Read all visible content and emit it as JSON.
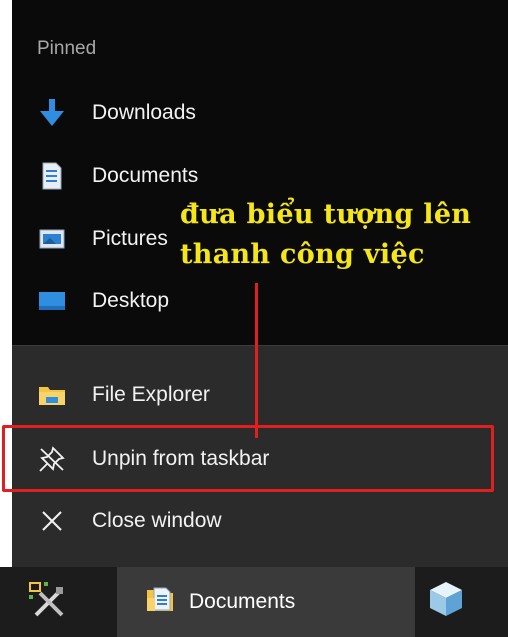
{
  "jumplist": {
    "pinned_header": "Pinned",
    "pinned_items": [
      {
        "label": "Downloads",
        "icon": "download-arrow-icon"
      },
      {
        "label": "Documents",
        "icon": "document-icon"
      },
      {
        "label": "Pictures",
        "icon": "pictures-icon"
      },
      {
        "label": "Desktop",
        "icon": "desktop-icon"
      }
    ],
    "actions": [
      {
        "label": "File Explorer",
        "icon": "file-explorer-icon"
      },
      {
        "label": "Unpin from taskbar",
        "icon": "unpin-icon"
      },
      {
        "label": "Close window",
        "icon": "close-icon"
      }
    ]
  },
  "annotation": {
    "line1": "đưa biểu tượng lên",
    "line2": "thanh công việc"
  },
  "taskbar": {
    "items": [
      {
        "label": "",
        "icon": "tools-icon"
      },
      {
        "label": "Documents",
        "icon": "folder-icon"
      },
      {
        "label": "",
        "icon": "cube-icon"
      }
    ]
  },
  "colors": {
    "pinned_bg": "#0a0a0a",
    "actions_bg": "#2b2b2b",
    "highlight": "#e02020",
    "annotation_text": "#f5e61a",
    "accent_blue": "#2f8ee0"
  }
}
